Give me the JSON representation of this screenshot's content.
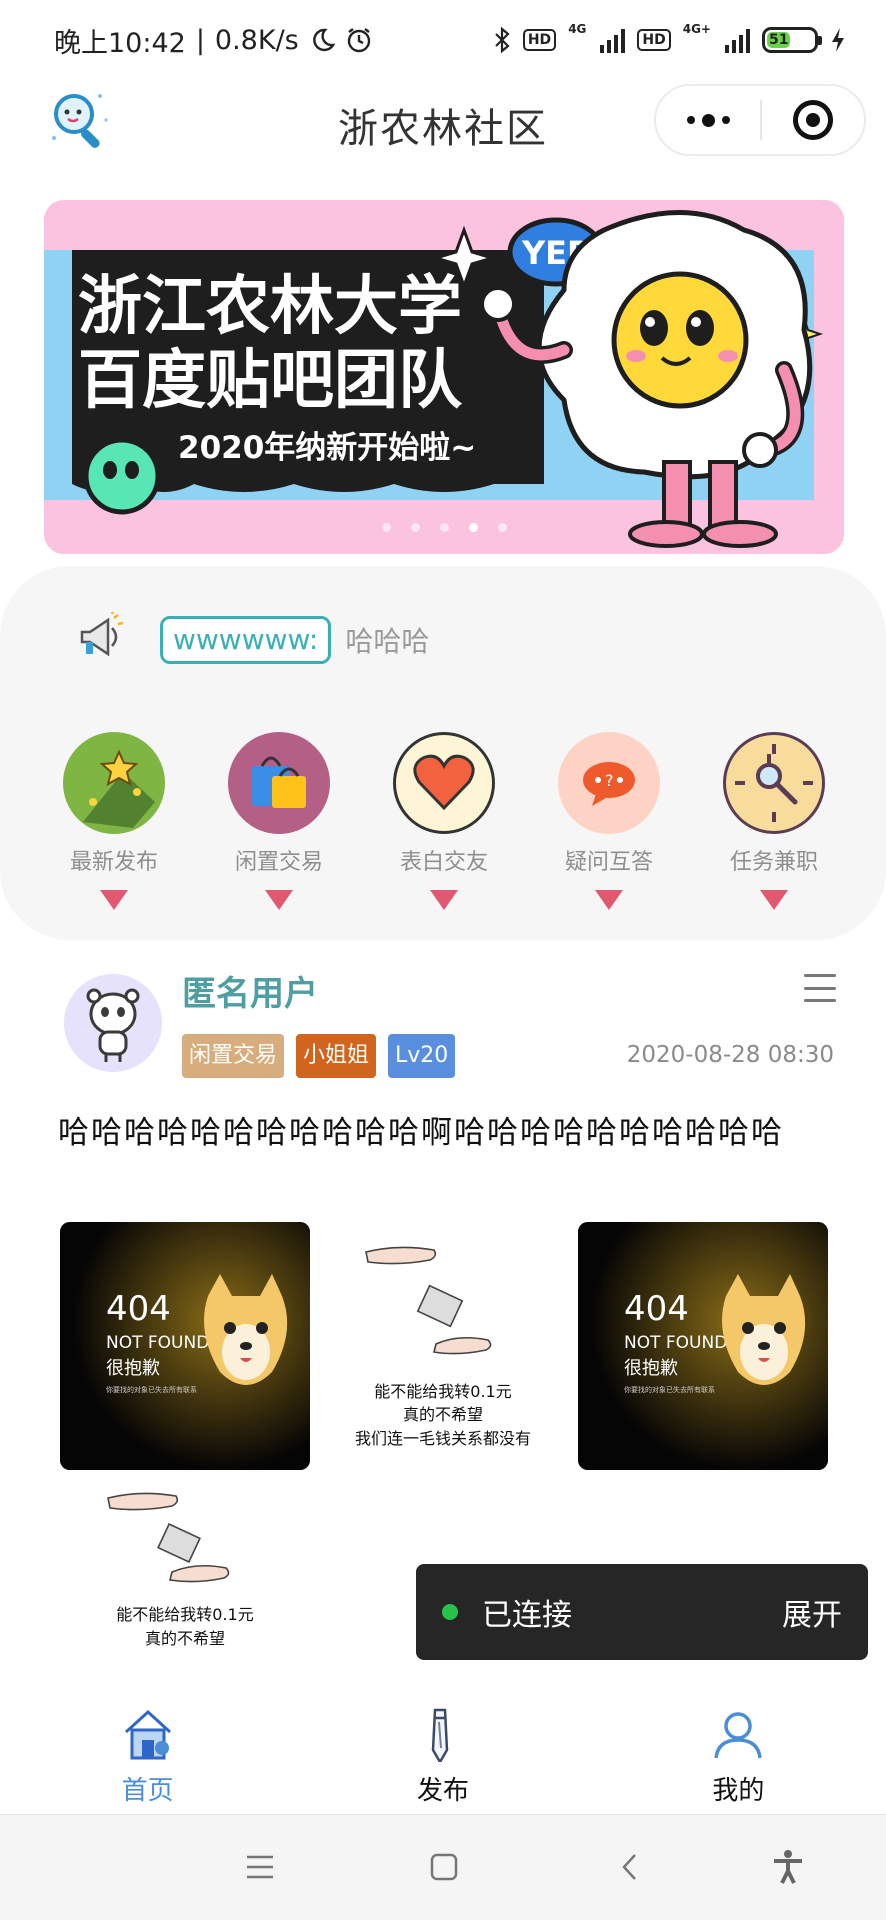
{
  "status_bar": {
    "time": "晚上10:42",
    "speed": "0.8K/s",
    "network1": "4G",
    "network2": "4G+",
    "hd_label": "HD",
    "battery": "51"
  },
  "header": {
    "title": "浙农林社区"
  },
  "banner": {
    "line1": "浙江农林大学",
    "line2": "百度贴吧团队",
    "subtitle": "2020年纳新开始啦~",
    "badge": "YEP",
    "slide_count": 5,
    "active_slide": 4,
    "colors": {
      "background": "#fbc3e0",
      "dark": "#1e1e1e",
      "accent_blue": "#8fd2f4"
    }
  },
  "notice": {
    "tag": "wwwwww:",
    "text": "哈哈哈"
  },
  "categories": [
    {
      "label": "最新发布",
      "icon": "shooting-star-icon",
      "color": "#7fb542"
    },
    {
      "label": "闲置交易",
      "icon": "shopping-bag-icon",
      "color": "#b45f86"
    },
    {
      "label": "表白交友",
      "icon": "heart-icon",
      "color": "#fdf5d6"
    },
    {
      "label": "疑问互答",
      "icon": "chat-bubble-icon",
      "color": "#fdd3c6"
    },
    {
      "label": "任务兼职",
      "icon": "clock-magnifier-icon",
      "color": "#f8dc9b"
    }
  ],
  "post": {
    "author": "匿名用户",
    "tags": [
      {
        "label": "闲置交易",
        "color": "#d8ad7d"
      },
      {
        "label": "小姐姐",
        "color": "#d2651e"
      },
      {
        "label": "Lv20",
        "color": "#5a8fe0"
      }
    ],
    "time": "2020-08-28 08:30",
    "content": "哈哈哈哈哈哈哈哈哈哈哈啊哈哈哈哈哈哈哈哈哈哈",
    "images": [
      {
        "type": "404",
        "title": "404",
        "line1": "NOT FOUND",
        "line2": "很抱歉",
        "line3": "你要找的对象已失去所有联系"
      },
      {
        "type": "transfer",
        "line1": "能不能给我转0.1元",
        "line2": "真的不希望",
        "line3": "我们连一毛钱关系都没有"
      },
      {
        "type": "404",
        "title": "404",
        "line1": "NOT FOUND",
        "line2": "很抱歉",
        "line3": "你要找的对象已失去所有联系"
      },
      {
        "type": "transfer",
        "line1": "能不能给我转0.1元",
        "line2": "真的不希望"
      }
    ]
  },
  "toast": {
    "status": "已连接",
    "action": "展开"
  },
  "tabbar": {
    "items": [
      {
        "label": "首页",
        "icon": "home-icon",
        "active": true
      },
      {
        "label": "发布",
        "icon": "pencil-icon",
        "active": false
      },
      {
        "label": "我的",
        "icon": "user-icon",
        "active": false
      }
    ]
  }
}
